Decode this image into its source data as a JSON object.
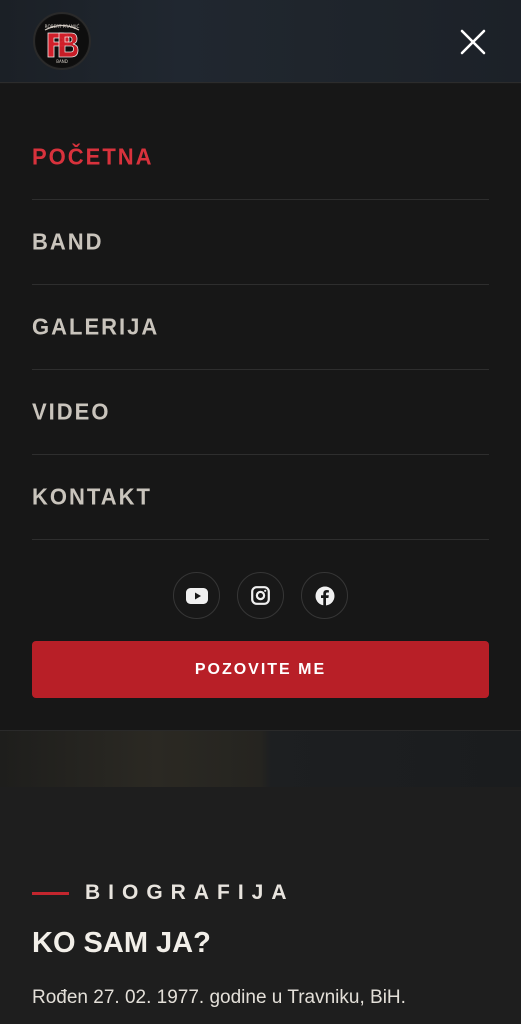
{
  "header": {
    "logo_text": "ROBERT PRANJIĆ BAND",
    "close_icon": "close-icon"
  },
  "menu": {
    "items": [
      {
        "label": "POČETNA",
        "active": true
      },
      {
        "label": "BAND",
        "active": false
      },
      {
        "label": "GALERIJA",
        "active": false
      },
      {
        "label": "VIDEO",
        "active": false
      },
      {
        "label": "KONTAKT",
        "active": false
      }
    ],
    "socials": [
      "youtube-icon",
      "instagram-icon",
      "facebook-icon"
    ],
    "cta_label": "POZOVITE ME"
  },
  "bio": {
    "eyebrow": "BIOGRAFIJA",
    "title": "KO SAM JA?",
    "text": "Rođen 27. 02. 1977. godine u Travniku, BiH."
  },
  "colors": {
    "accent": "#b81f27",
    "active_link": "#d8323c",
    "link": "#c9c4bc",
    "background": "#171717"
  }
}
